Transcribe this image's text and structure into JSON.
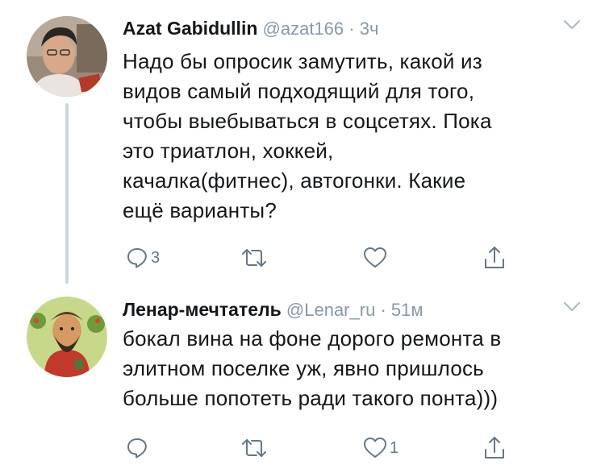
{
  "tweets": [
    {
      "name": "Azat Gabidullin",
      "handle": "@azat166",
      "separator": "·",
      "time": "3ч",
      "lines": [
        "Надо бы опросик замутить, какой из",
        "видов самый подходящий для того,",
        "чтобы выебываться в соцсетях. Пока",
        "это триатлон, хоккей,",
        "качалка(фитнес), автогонки. Какие",
        "ещё варианты?"
      ],
      "actions": {
        "reply_count": "3",
        "retweet_count": "",
        "like_count": ""
      }
    },
    {
      "name": "Ленар-мечтатель",
      "handle": "@Lenar_ru",
      "separator": "·",
      "time": "51м",
      "lines": [
        "бокал вина на фоне дорого ремонта в",
        "элитном поселке уж, явно пришлось",
        "больше попотеть ради такого понта)))"
      ],
      "actions": {
        "reply_count": "",
        "retweet_count": "",
        "like_count": "1"
      }
    }
  ],
  "icons": {
    "reply": "reply-icon",
    "retweet": "retweet-icon",
    "like": "heart-icon",
    "share": "share-icon",
    "menu": "chevron-down-icon"
  },
  "colors": {
    "text": "#14171a",
    "secondary": "#8899a6",
    "icon": "#657786",
    "thread_line": "#ccd6dd"
  }
}
